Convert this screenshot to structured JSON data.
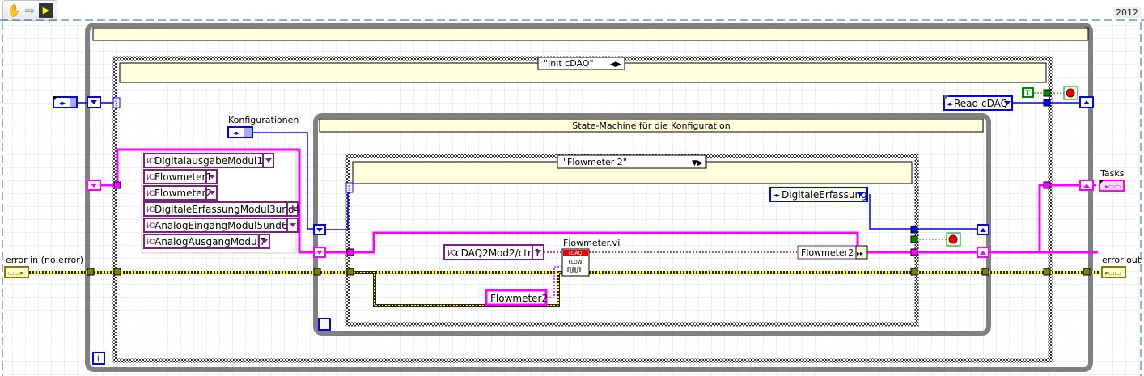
{
  "toolbar": {
    "items": [
      {
        "icon": "hand-icon"
      },
      {
        "icon": "arrow-right-icon"
      },
      {
        "icon": "vi-icon"
      }
    ],
    "version": "2012"
  },
  "outer_case": {
    "selector": "\"Init cDAQ\""
  },
  "inner_loop": {
    "title": "State-Machine für die Konfiguration"
  },
  "inner_case": {
    "selector": "\"Flowmeter 2\""
  },
  "labels": {
    "konfigurationen": "Konfigurationen",
    "tasks": "Tasks",
    "error_in": "error in (no error)",
    "error_out": "error out",
    "subvi": "Flowmeter.vi",
    "subvi_header": "cDAQ",
    "subvi_body": "FLOW"
  },
  "constants": {
    "modules": [
      "DigitalausgabeModul1",
      "Flowmeter1",
      "Flowmeter2",
      "DigitaleErfassungModul3und4",
      "AnalogEingangModul5und6",
      "AnalogAusgangModul7"
    ],
    "channel": "cDAQ2Mod2/ctrl1",
    "flowmeter_string": "Flowmeter2",
    "bundle_label": "Flowmeter2",
    "next_state_inner": "DigitaleErfassung",
    "next_state_outer": "Read cDAQ",
    "true_const": "T",
    "iteration": "i"
  },
  "colors": {
    "enum_wire": "#0000ff",
    "cluster_wire": "#ff00ff",
    "error_wire": "#808000",
    "task_wire": "#7f1f7f",
    "bool_wire": "#007f00",
    "loop": "#808080",
    "header": "#ffffdd"
  }
}
